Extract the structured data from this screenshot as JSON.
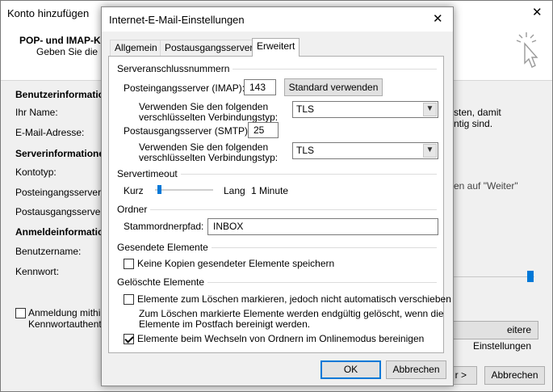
{
  "bg": {
    "title": "Konto hinzufügen",
    "header_title": "POP- und IMAP-Ko",
    "header_subtitle": "Geben Sie die E-M",
    "sec_user": "Benutzerinformationen",
    "ihr_name": "Ihr Name:",
    "email": "E-Mail-Adresse:",
    "sec_server": "Serverinformationen",
    "kontotyp": "Kontotyp:",
    "posteingangsserver": "Posteingangsserver:",
    "postausgangsserver": "Postausgangsserver (",
    "sec_login": "Anmeldeinformationen",
    "benutzername": "Benutzername:",
    "kennwort": "Kennwort:",
    "right_text_1": "sten, damit",
    "right_text_2": "ntig sind.",
    "right_text_3": "en auf \"Weiter\"",
    "spa_line1": "Anmeldung mithil",
    "spa_line2": "Kennwortauthent",
    "more_settings": "eitere Einstellungen",
    "next": "r >",
    "cancel": "Abbrechen"
  },
  "dialog": {
    "title": "Internet-E-Mail-Einstellungen",
    "close_glyph": "✕",
    "tabs": [
      "Allgemein",
      "Postausgangsserver",
      "Erweitert"
    ],
    "server_ports": {
      "heading": "Serveranschlussnummern",
      "incoming_label": "Posteingangsserver (IMAP):",
      "incoming_value": "143",
      "default_button": "Standard verwenden",
      "enc_label_1": "Verwenden Sie den folgenden",
      "enc_label_2": "verschlüsselten Verbindungstyp:",
      "incoming_enc": "TLS",
      "outgoing_label": "Postausgangsserver (SMTP):",
      "outgoing_value": "25",
      "outgoing_enc": "TLS"
    },
    "timeout": {
      "heading": "Servertimeout",
      "short": "Kurz",
      "long": "Lang",
      "value": "1 Minute",
      "level": 0.05
    },
    "folders": {
      "heading": "Ordner",
      "root_label": "Stammordnerpfad:",
      "root_value": "INBOX"
    },
    "sent": {
      "heading": "Gesendete Elemente",
      "no_copies": "Keine Kopien gesendeter Elemente speichern"
    },
    "deleted": {
      "heading": "Gelöschte Elemente",
      "mark_delete": "Elemente zum Löschen markieren, jedoch nicht automatisch verschieben",
      "note_1": "Zum Löschen markierte Elemente werden endgültig gelöscht, wenn die",
      "note_2": "Elemente im Postfach bereinigt werden.",
      "purge": "Elemente beim Wechseln von Ordnern im Onlinemodus bereinigen"
    },
    "ok": "OK",
    "cancel": "Abbrechen"
  }
}
